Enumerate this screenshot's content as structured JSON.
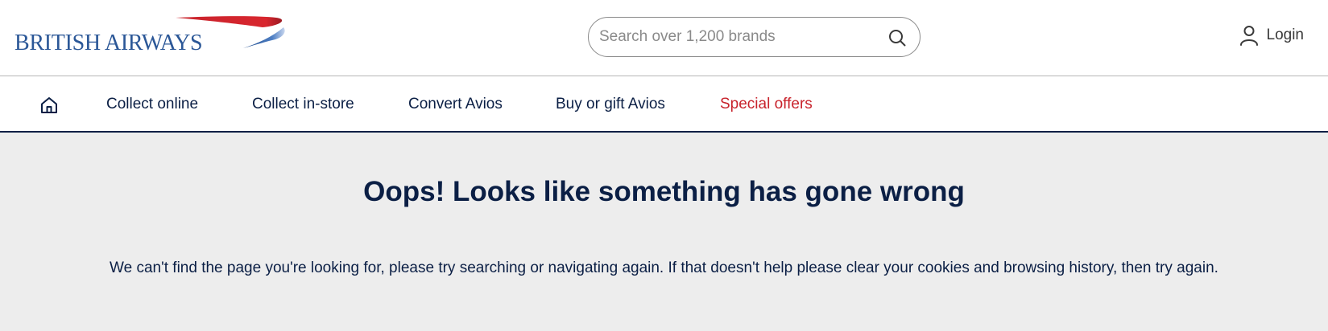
{
  "header": {
    "logo_text": "BRITISH AIRWAYS",
    "search_placeholder": "Search over 1,200 brands",
    "login_label": "Login"
  },
  "nav": {
    "home_icon": "home-icon",
    "items": [
      {
        "label": "Collect online"
      },
      {
        "label": "Collect in-store"
      },
      {
        "label": "Convert Avios"
      },
      {
        "label": "Buy or gift Avios"
      },
      {
        "label": "Special offers"
      }
    ]
  },
  "main": {
    "title": "Oops! Looks like something has gone wrong",
    "message": "We can't find the page you're looking for, please try searching or navigating again. If that doesn't help please clear your cookies and browsing history, then try again."
  },
  "colors": {
    "brand_navy": "#0b1f45",
    "brand_blue": "#2b5797",
    "brand_red": "#c8232c",
    "error_background": "#ededed"
  }
}
